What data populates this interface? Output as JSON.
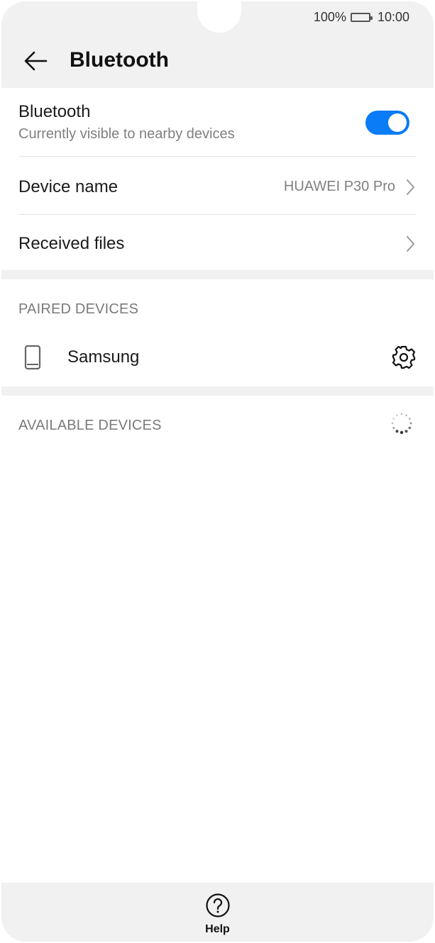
{
  "status_bar": {
    "battery_percent": "100%",
    "time": "10:00"
  },
  "header": {
    "title": "Bluetooth"
  },
  "bluetooth_row": {
    "label": "Bluetooth",
    "subtitle": "Currently visible to nearby devices",
    "enabled": true
  },
  "device_name_row": {
    "label": "Device name",
    "value": "HUAWEI P30 Pro"
  },
  "received_files_row": {
    "label": "Received files"
  },
  "paired": {
    "header": "PAIRED DEVICES",
    "devices": [
      {
        "name": "Samsung",
        "icon": "phone-icon"
      }
    ]
  },
  "available": {
    "header": "AVAILABLE DEVICES",
    "icon": "loading-spinner-icon"
  },
  "bottom_bar": {
    "help_label": "Help",
    "help_icon": "question-circle-icon"
  },
  "colors": {
    "accent": "#0a7cf5",
    "background_gray": "#f1f1f1",
    "secondary_text": "#808080"
  }
}
